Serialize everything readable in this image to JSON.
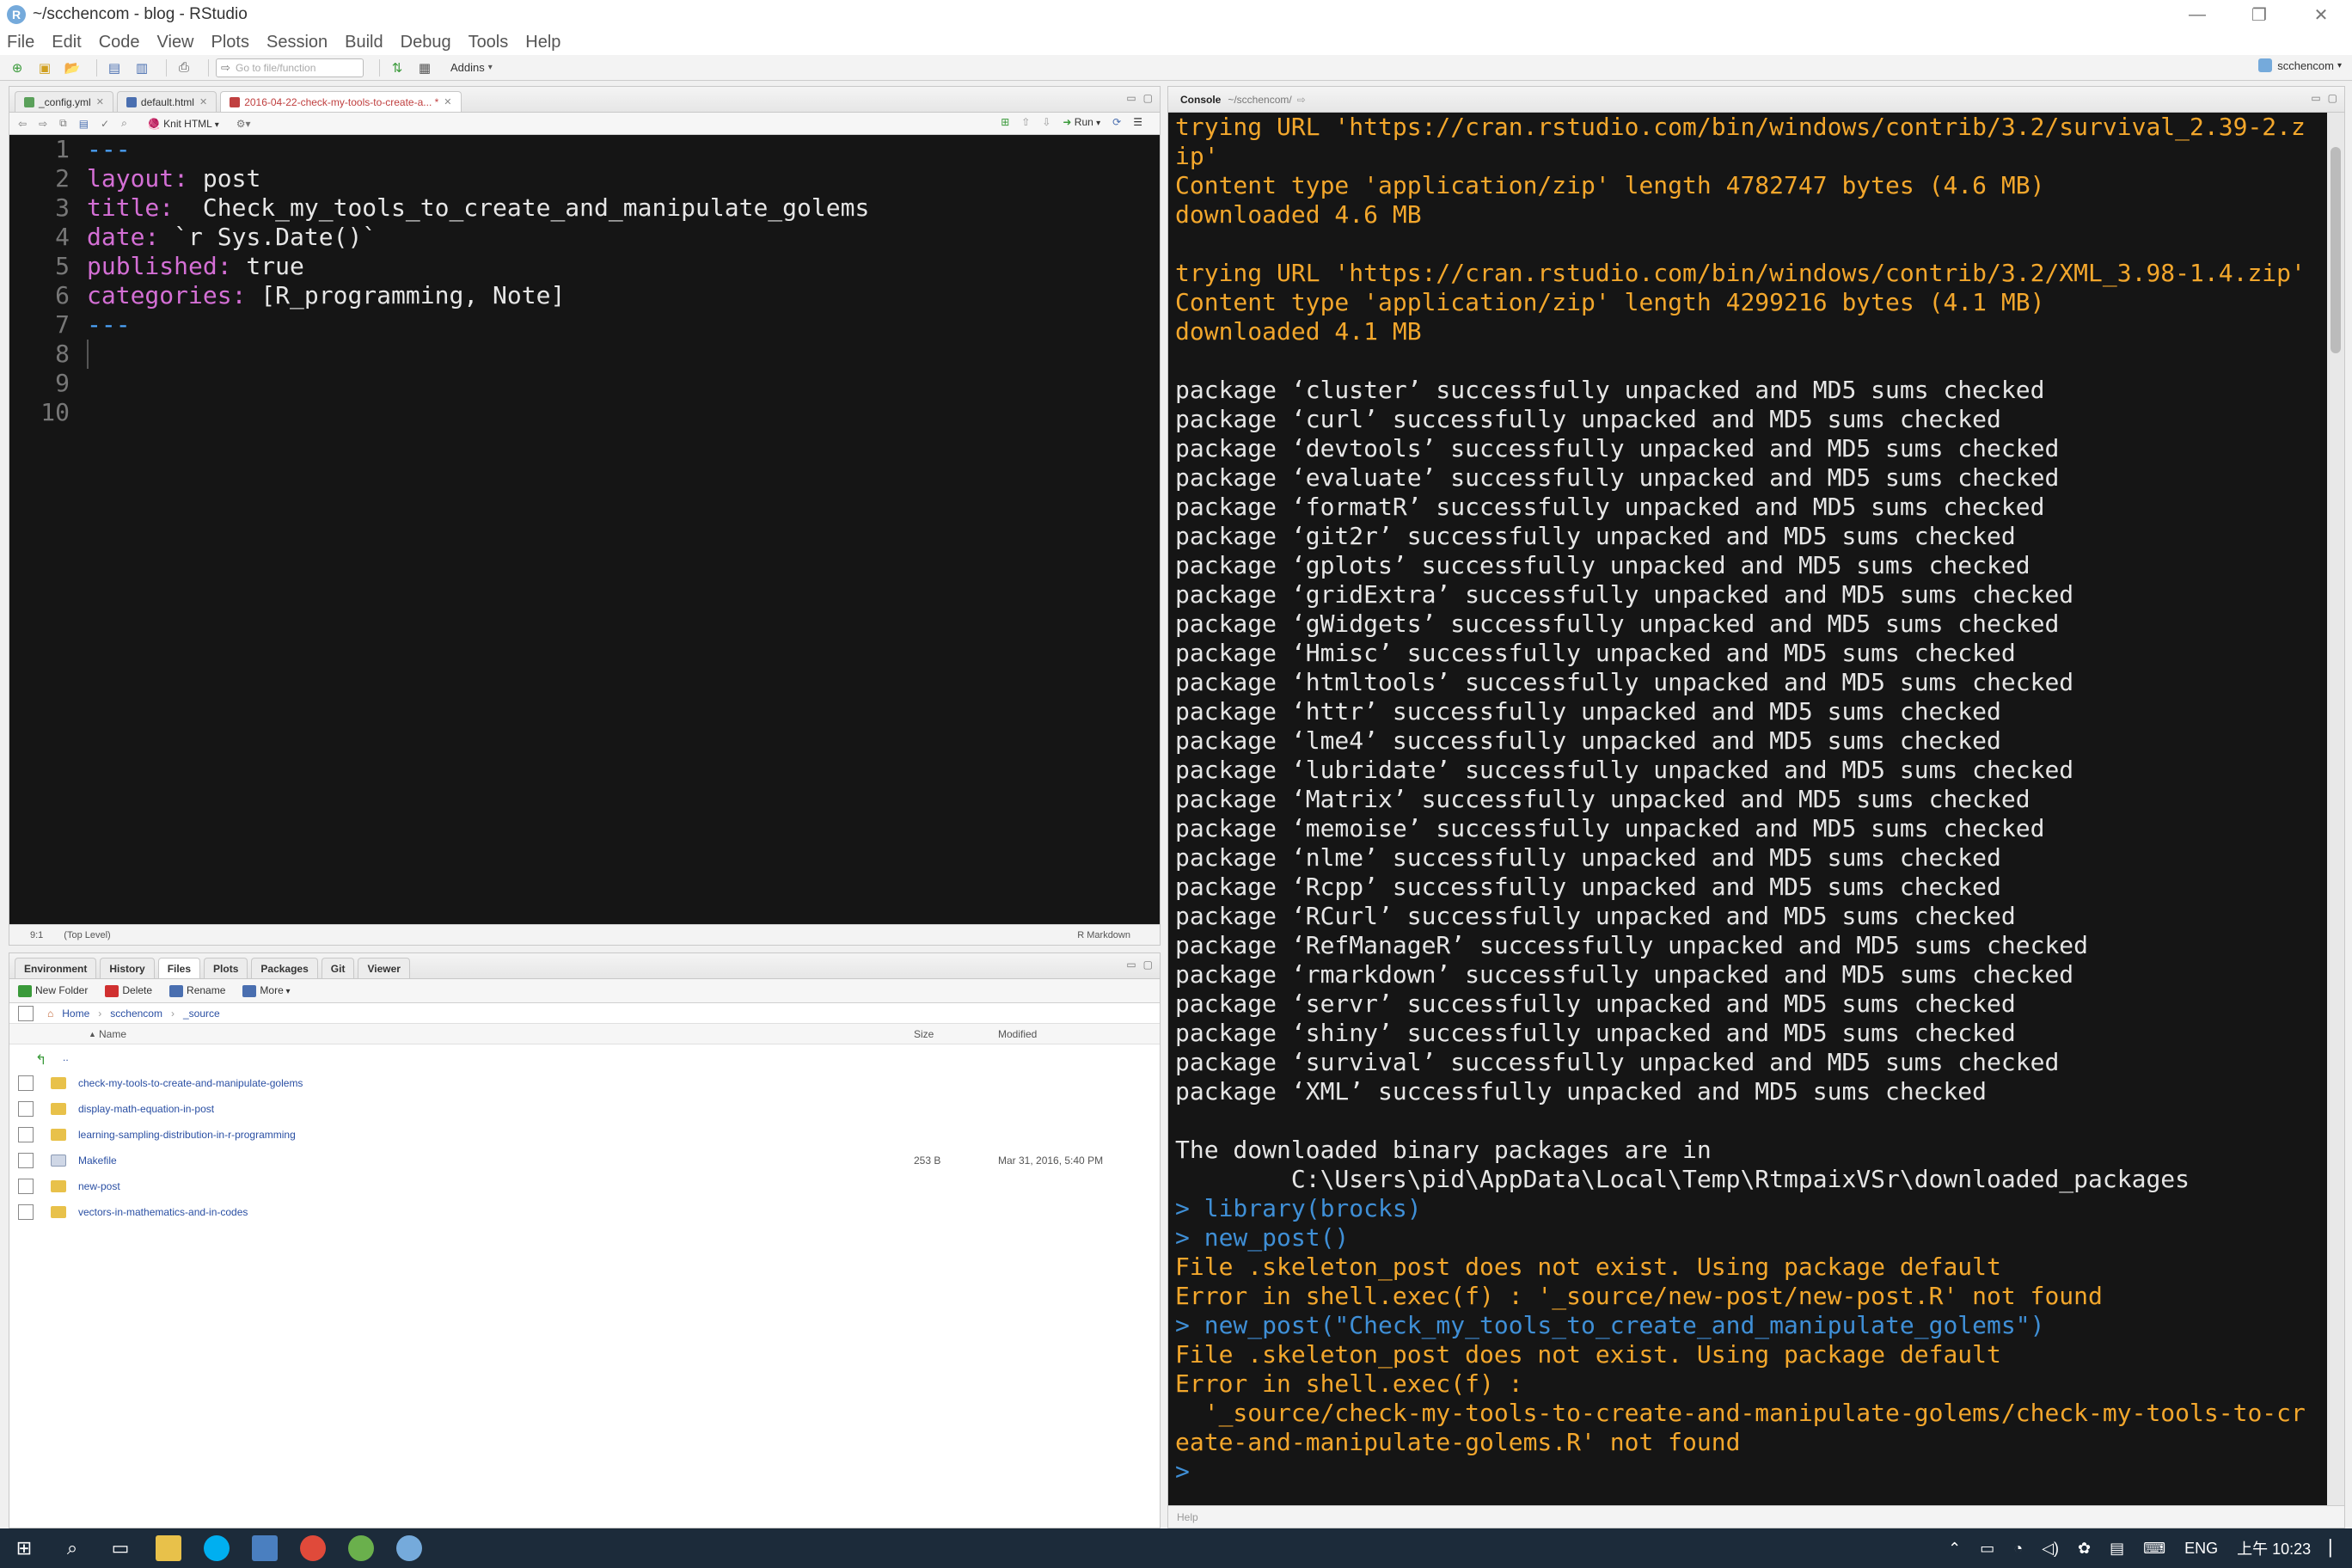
{
  "window": {
    "title": "~/scchencom - blog - RStudio"
  },
  "menu": [
    "File",
    "Edit",
    "Code",
    "View",
    "Plots",
    "Session",
    "Build",
    "Debug",
    "Tools",
    "Help"
  ],
  "toolbar": {
    "goto_placeholder": "Go to file/function",
    "addins": "Addins",
    "project": "scchencom"
  },
  "source": {
    "tabs": [
      {
        "label": "_config.yml",
        "active": false
      },
      {
        "label": "default.html",
        "active": false
      },
      {
        "label": "2016-04-22-check-my-tools-to-create-a... *",
        "active": true
      }
    ],
    "knit": "Knit HTML",
    "run": "Run",
    "lines": [
      {
        "n": "1",
        "parts": [
          [
            "dash",
            "---"
          ]
        ]
      },
      {
        "n": "2",
        "parts": [
          [
            "k",
            "layout:"
          ],
          [
            "v",
            " post"
          ]
        ]
      },
      {
        "n": "3",
        "parts": [
          [
            "k",
            "title:"
          ],
          [
            "v",
            "  Check_my_tools_to_create_and_manipulate_golems"
          ]
        ]
      },
      {
        "n": "4",
        "parts": [
          [
            "k",
            "date:"
          ],
          [
            "v",
            " `r Sys.Date()`"
          ]
        ]
      },
      {
        "n": "5",
        "parts": [
          [
            "k",
            "published:"
          ],
          [
            "v",
            " true"
          ]
        ]
      },
      {
        "n": "6",
        "parts": [
          [
            "k",
            "categories:"
          ],
          [
            "v",
            " [R_programming, Note]"
          ]
        ]
      },
      {
        "n": "7",
        "parts": [
          [
            "dash",
            "---"
          ]
        ]
      },
      {
        "n": "8",
        "parts": []
      },
      {
        "n": "9",
        "parts": []
      },
      {
        "n": "10",
        "parts": []
      }
    ],
    "status": {
      "position": "9:1",
      "scope": "(Top Level)",
      "mode": "R Markdown"
    }
  },
  "files": {
    "tabs": [
      "Environment",
      "History",
      "Files",
      "Plots",
      "Packages",
      "Git",
      "Viewer"
    ],
    "active_tab": "Files",
    "actions": [
      "New Folder",
      "Delete",
      "Rename",
      "More"
    ],
    "breadcrumb": [
      "Home",
      "scchencom",
      "_source"
    ],
    "columns": {
      "name": "Name",
      "size": "Size",
      "modified": "Modified"
    },
    "rows": [
      {
        "name": "..",
        "type": "up",
        "size": "",
        "modified": ""
      },
      {
        "name": "check-my-tools-to-create-and-manipulate-golems",
        "type": "folder",
        "size": "",
        "modified": ""
      },
      {
        "name": "display-math-equation-in-post",
        "type": "folder",
        "size": "",
        "modified": ""
      },
      {
        "name": "learning-sampling-distribution-in-r-programming",
        "type": "folder",
        "size": "",
        "modified": ""
      },
      {
        "name": "Makefile",
        "type": "file",
        "size": "253 B",
        "modified": "Mar 31, 2016, 5:40 PM"
      },
      {
        "name": "new-post",
        "type": "folder",
        "size": "",
        "modified": ""
      },
      {
        "name": "vectors-in-mathematics-and-in-codes",
        "type": "folder",
        "size": "",
        "modified": ""
      }
    ]
  },
  "console": {
    "title": "Console",
    "path": "~/scchencom/",
    "lines": [
      [
        "o",
        "trying URL 'https://cran.rstudio.com/bin/windows/contrib/3.2/survival_2.39-2.z"
      ],
      [
        "o",
        "ip'"
      ],
      [
        "o",
        "Content type 'application/zip' length 4782747 bytes (4.6 MB)"
      ],
      [
        "o",
        "downloaded 4.6 MB"
      ],
      [
        "o",
        ""
      ],
      [
        "o",
        "trying URL 'https://cran.rstudio.com/bin/windows/contrib/3.2/XML_3.98-1.4.zip'"
      ],
      [
        "o",
        "Content type 'application/zip' length 4299216 bytes (4.1 MB)"
      ],
      [
        "o",
        "downloaded 4.1 MB"
      ],
      [
        "w",
        ""
      ],
      [
        "w",
        "package ‘cluster’ successfully unpacked and MD5 sums checked"
      ],
      [
        "w",
        "package ‘curl’ successfully unpacked and MD5 sums checked"
      ],
      [
        "w",
        "package ‘devtools’ successfully unpacked and MD5 sums checked"
      ],
      [
        "w",
        "package ‘evaluate’ successfully unpacked and MD5 sums checked"
      ],
      [
        "w",
        "package ‘formatR’ successfully unpacked and MD5 sums checked"
      ],
      [
        "w",
        "package ‘git2r’ successfully unpacked and MD5 sums checked"
      ],
      [
        "w",
        "package ‘gplots’ successfully unpacked and MD5 sums checked"
      ],
      [
        "w",
        "package ‘gridExtra’ successfully unpacked and MD5 sums checked"
      ],
      [
        "w",
        "package ‘gWidgets’ successfully unpacked and MD5 sums checked"
      ],
      [
        "w",
        "package ‘Hmisc’ successfully unpacked and MD5 sums checked"
      ],
      [
        "w",
        "package ‘htmltools’ successfully unpacked and MD5 sums checked"
      ],
      [
        "w",
        "package ‘httr’ successfully unpacked and MD5 sums checked"
      ],
      [
        "w",
        "package ‘lme4’ successfully unpacked and MD5 sums checked"
      ],
      [
        "w",
        "package ‘lubridate’ successfully unpacked and MD5 sums checked"
      ],
      [
        "w",
        "package ‘Matrix’ successfully unpacked and MD5 sums checked"
      ],
      [
        "w",
        "package ‘memoise’ successfully unpacked and MD5 sums checked"
      ],
      [
        "w",
        "package ‘nlme’ successfully unpacked and MD5 sums checked"
      ],
      [
        "w",
        "package ‘Rcpp’ successfully unpacked and MD5 sums checked"
      ],
      [
        "w",
        "package ‘RCurl’ successfully unpacked and MD5 sums checked"
      ],
      [
        "w",
        "package ‘RefManageR’ successfully unpacked and MD5 sums checked"
      ],
      [
        "w",
        "package ‘rmarkdown’ successfully unpacked and MD5 sums checked"
      ],
      [
        "w",
        "package ‘servr’ successfully unpacked and MD5 sums checked"
      ],
      [
        "w",
        "package ‘shiny’ successfully unpacked and MD5 sums checked"
      ],
      [
        "w",
        "package ‘survival’ successfully unpacked and MD5 sums checked"
      ],
      [
        "w",
        "package ‘XML’ successfully unpacked and MD5 sums checked"
      ],
      [
        "w",
        ""
      ],
      [
        "w",
        "The downloaded binary packages are in"
      ],
      [
        "w",
        "        C:\\Users\\pid\\AppData\\Local\\Temp\\RtmpaixVSr\\downloaded_packages"
      ],
      [
        "c",
        "> library(brocks)"
      ],
      [
        "c",
        "> new_post()"
      ],
      [
        "o",
        "File .skeleton_post does not exist. Using package default"
      ],
      [
        "o",
        "Error in shell.exec(f) : '_source/new-post/new-post.R' not found"
      ],
      [
        "c",
        "> new_post(\"Check_my_tools_to_create_and_manipulate_golems\")"
      ],
      [
        "o",
        "File .skeleton_post does not exist. Using package default"
      ],
      [
        "o",
        "Error in shell.exec(f) :"
      ],
      [
        "o",
        "  '_source/check-my-tools-to-create-and-manipulate-golems/check-my-tools-to-cr"
      ],
      [
        "o",
        "eate-and-manipulate-golems.R' not found"
      ],
      [
        "c",
        "> "
      ]
    ],
    "footer": "Help"
  },
  "taskbar": {
    "lang": "ENG",
    "time": "上午 10:23"
  }
}
